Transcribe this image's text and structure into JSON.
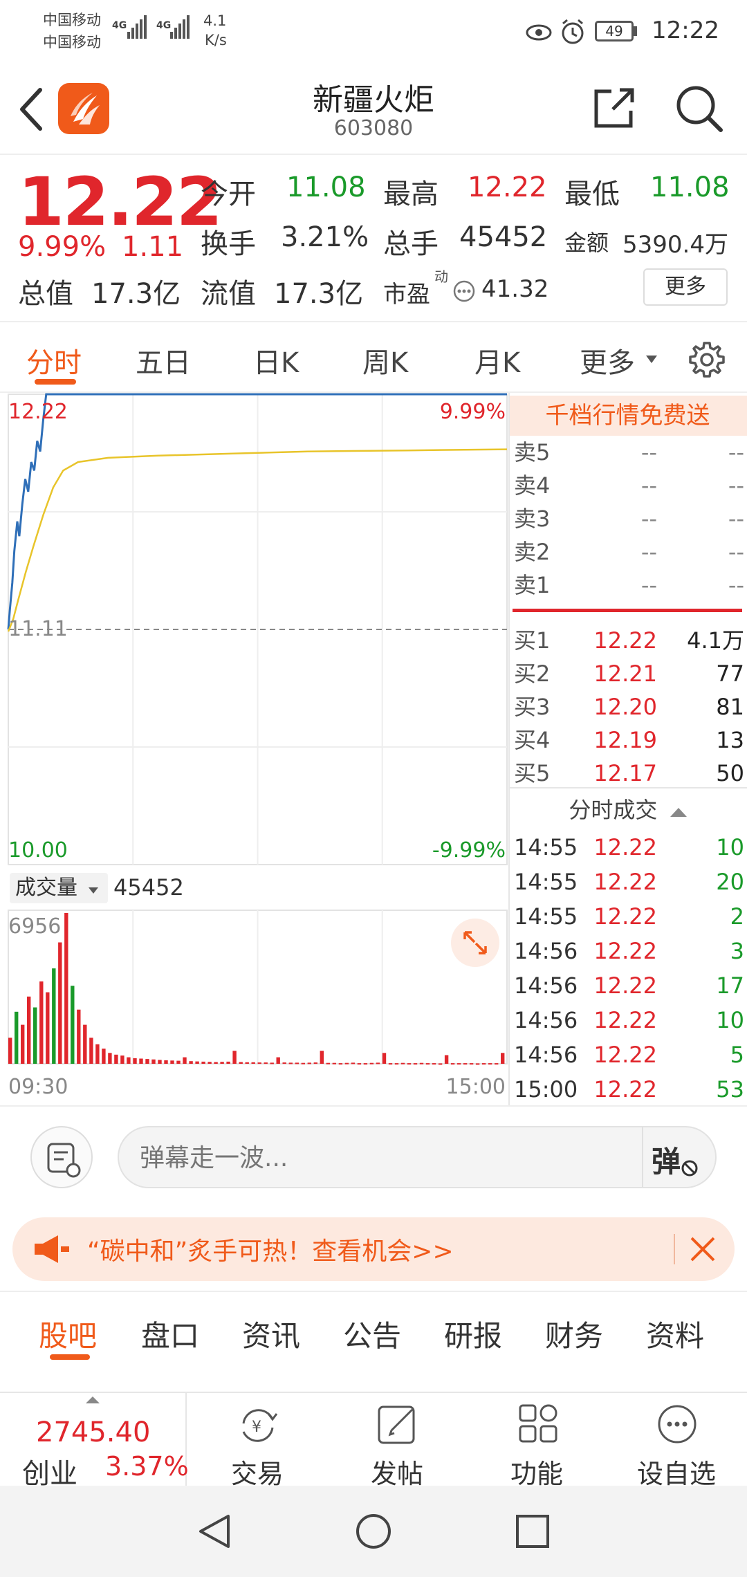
{
  "status": {
    "carrier1": "中国移动",
    "carrier2": "中国移动",
    "net1": "4G",
    "net2": "4G",
    "speed_value": "4.1",
    "speed_unit": "K/s",
    "battery": "49",
    "time": "12:22"
  },
  "header": {
    "name": "新疆火炬",
    "code": "603080"
  },
  "quote": {
    "price": "12.22",
    "change_pct": "9.99%",
    "change": "1.11",
    "open_label": "今开",
    "open": "11.08",
    "high_label": "最高",
    "high": "12.22",
    "low_label": "最低",
    "low": "11.08",
    "turnover_label": "换手",
    "turnover": "3.21%",
    "volume_label": "总手",
    "volume": "45452",
    "amount_label": "金额",
    "amount": "5390.4万",
    "mktcap_label": "总值",
    "mktcap": "17.3亿",
    "float_label": "流值",
    "float": "17.3亿",
    "pe_label": "市盈",
    "pe_sup": "动",
    "pe": "41.32",
    "more": "更多"
  },
  "tabs": [
    "分时",
    "五日",
    "日K",
    "周K",
    "月K",
    "更多"
  ],
  "chart": {
    "top_price": "12.22",
    "top_pct": "9.99%",
    "mid_price": "11.11",
    "bottom_price": "10.00",
    "bottom_pct": "-9.99%",
    "vol_selector": "成交量",
    "vol_value": "45452",
    "vol_max": "6956",
    "time_start": "09:30",
    "time_end": "15:00"
  },
  "chart_data": {
    "type": "line",
    "title": "",
    "xlabel": "",
    "ylabel": "",
    "ylim": [
      10.0,
      12.22
    ],
    "x_ticks": [
      "09:30",
      "15:00"
    ],
    "series": [
      {
        "name": "",
        "color": "#2f6fb8",
        "points": [
          [
            0,
            11.11
          ],
          [
            0.003,
            11.2
          ],
          [
            0.008,
            11.33
          ],
          [
            0.012,
            11.48
          ],
          [
            0.018,
            11.62
          ],
          [
            0.022,
            11.55
          ],
          [
            0.028,
            11.7
          ],
          [
            0.034,
            11.82
          ],
          [
            0.04,
            11.76
          ],
          [
            0.046,
            11.9
          ],
          [
            0.052,
            11.86
          ],
          [
            0.058,
            12.0
          ],
          [
            0.064,
            11.95
          ],
          [
            0.07,
            12.1
          ],
          [
            0.076,
            12.22
          ],
          [
            0.082,
            12.22
          ],
          [
            0.09,
            12.22
          ],
          [
            1.0,
            12.22
          ]
        ]
      },
      {
        "name": "",
        "color": "#e8c42a",
        "points": [
          [
            0,
            11.1
          ],
          [
            0.01,
            11.16
          ],
          [
            0.02,
            11.25
          ],
          [
            0.035,
            11.38
          ],
          [
            0.05,
            11.5
          ],
          [
            0.07,
            11.65
          ],
          [
            0.09,
            11.78
          ],
          [
            0.11,
            11.86
          ],
          [
            0.14,
            11.9
          ],
          [
            0.2,
            11.92
          ],
          [
            0.3,
            11.93
          ],
          [
            0.45,
            11.94
          ],
          [
            0.6,
            11.95
          ],
          [
            0.8,
            11.955
          ],
          [
            1.0,
            11.96
          ]
        ]
      }
    ],
    "volume": {
      "max": 6956,
      "bars": [
        1200,
        2400,
        1800,
        3100,
        2600,
        3800,
        3300,
        4400,
        5600,
        6956,
        3600,
        2500,
        1800,
        1200,
        900,
        700,
        500,
        420,
        380,
        300,
        260,
        240,
        220,
        200,
        180,
        160,
        150,
        140,
        300,
        120,
        110,
        100,
        90,
        80,
        90,
        100,
        600,
        80,
        70,
        70,
        60,
        60,
        50,
        300,
        60,
        50,
        50,
        40,
        50,
        60,
        600,
        40,
        40,
        30,
        40,
        50,
        30,
        30,
        40,
        50,
        500,
        30,
        30,
        40,
        30,
        30,
        40,
        30,
        30,
        20,
        400,
        30,
        30,
        30,
        30,
        20,
        30,
        30,
        30,
        500
      ]
    }
  },
  "orderbook": {
    "promo": "千档行情免费送",
    "asks": [
      {
        "label": "卖5",
        "price": "--",
        "vol": "--"
      },
      {
        "label": "卖4",
        "price": "--",
        "vol": "--"
      },
      {
        "label": "卖3",
        "price": "--",
        "vol": "--"
      },
      {
        "label": "卖2",
        "price": "--",
        "vol": "--"
      },
      {
        "label": "卖1",
        "price": "--",
        "vol": "--"
      }
    ],
    "bids": [
      {
        "label": "买1",
        "price": "12.22",
        "vol": "4.1万"
      },
      {
        "label": "买2",
        "price": "12.21",
        "vol": "77"
      },
      {
        "label": "买3",
        "price": "12.20",
        "vol": "81"
      },
      {
        "label": "买4",
        "price": "12.19",
        "vol": "13"
      },
      {
        "label": "买5",
        "price": "12.17",
        "vol": "50"
      }
    ],
    "trades_title": "分时成交",
    "trades": [
      {
        "time": "14:55",
        "price": "12.22",
        "vol": "10"
      },
      {
        "time": "14:55",
        "price": "12.22",
        "vol": "20"
      },
      {
        "time": "14:55",
        "price": "12.22",
        "vol": "2"
      },
      {
        "time": "14:56",
        "price": "12.22",
        "vol": "3"
      },
      {
        "time": "14:56",
        "price": "12.22",
        "vol": "17"
      },
      {
        "time": "14:56",
        "price": "12.22",
        "vol": "10"
      },
      {
        "time": "14:56",
        "price": "12.22",
        "vol": "5"
      },
      {
        "time": "15:00",
        "price": "12.22",
        "vol": "53"
      }
    ]
  },
  "comment": {
    "placeholder": "弹幕走一波...",
    "danmu_btn": "弹"
  },
  "ad": {
    "text": "“碳中和”炙手可热！查看机会>>"
  },
  "bottom_tabs": [
    "股吧",
    "盘口",
    "资讯",
    "公告",
    "研报",
    "财务",
    "资料"
  ],
  "navbar": {
    "index_value": "2745.40",
    "index_name": "创业",
    "index_change": "3.37%",
    "items": [
      "交易",
      "发帖",
      "功能",
      "设自选"
    ]
  },
  "colors": {
    "accent": "#f05a1a",
    "up": "#e0262c",
    "down": "#1a9a2a",
    "price_line": "#2f6fb8",
    "avg_line": "#e8c42a"
  }
}
